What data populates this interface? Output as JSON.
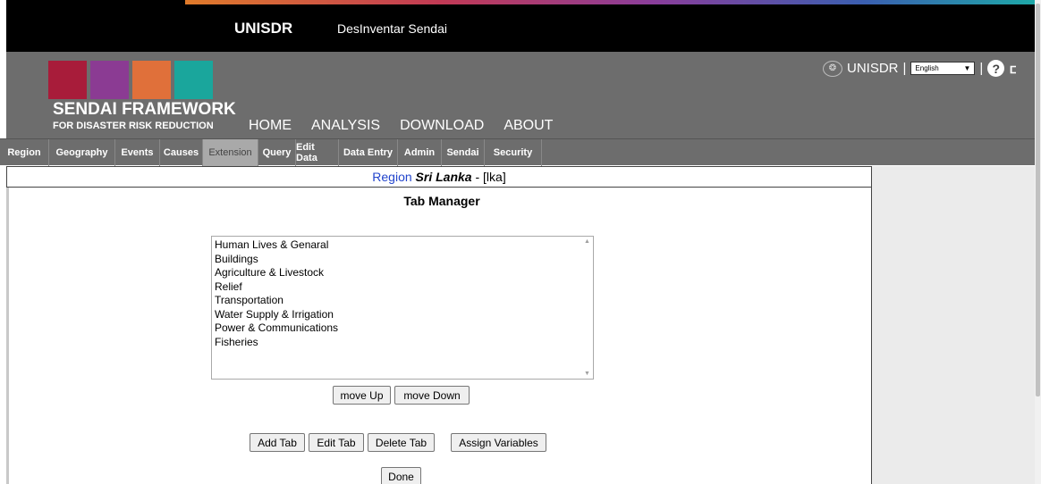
{
  "topbar": {
    "brand": "UNISDR",
    "app": "DesInventar Sendai"
  },
  "logo": {
    "title": "SENDAI FRAMEWORK",
    "subtitle": "FOR DISASTER RISK REDUCTION"
  },
  "main_nav": [
    "HOME",
    "ANALYSIS",
    "DOWNLOAD",
    "ABOUT"
  ],
  "header_right": {
    "org": "UNISDR",
    "sep1": "|",
    "language": "English",
    "sep2": "|"
  },
  "tabs": [
    "Region",
    "Geography",
    "Events",
    "Causes",
    "Extension",
    "Query",
    "Edit Data",
    "Data Entry",
    "Admin",
    "Sendai",
    "Security"
  ],
  "active_tab": "Extension",
  "region": {
    "label": "Region",
    "name": "Sri Lanka",
    "dash": "-",
    "code": "[lka]"
  },
  "tab_manager": {
    "title": "Tab Manager",
    "items": [
      "Human Lives & Genaral",
      "Buildings",
      "Agriculture & Livestock",
      "Relief",
      "Transportation",
      "Water Supply & Irrigation",
      "Power & Communications",
      "Fisheries"
    ],
    "buttons": {
      "move_up": "move Up",
      "move_down": "move Down",
      "add_tab": "Add Tab",
      "edit_tab": "Edit Tab",
      "delete_tab": "Delete Tab",
      "assign_variables": "Assign Variables",
      "done": "Done"
    }
  },
  "icons": {
    "un": "un-emblem-icon",
    "help": "help-icon",
    "dropdown": "dropdown-arrow-icon"
  },
  "colors": {
    "header_gray": "#6d6d6d",
    "active_tab": "#a9a9a9",
    "region_link": "#2244cc"
  }
}
